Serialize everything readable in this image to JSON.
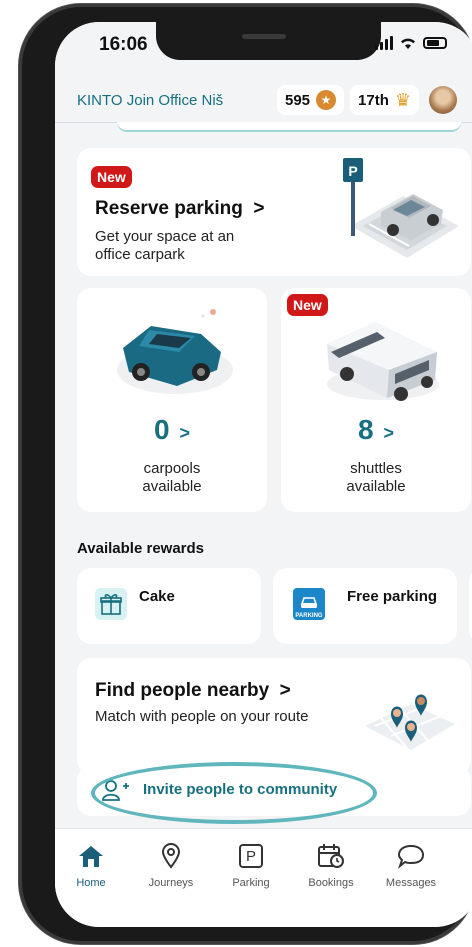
{
  "status_bar": {
    "time": "16:06"
  },
  "header": {
    "office": "KINTO Join Office Niš",
    "points": "595",
    "rank": "17th"
  },
  "reserve_parking": {
    "badge": "New",
    "title": "Reserve parking",
    "chevron": ">",
    "desc_line1": "Get your space at an",
    "desc_line2": "office carpark"
  },
  "carpools": {
    "count": "0",
    "chevron": ">",
    "label_line1": "carpools",
    "label_line2": "available"
  },
  "shuttles": {
    "badge": "New",
    "count": "8",
    "chevron": ">",
    "label_line1": "shuttles",
    "label_line2": "available"
  },
  "rewards": {
    "section_title": "Available rewards",
    "items": [
      {
        "label": "Cake"
      },
      {
        "label": "Free parking",
        "icon_text": "PARKING"
      }
    ]
  },
  "find_people": {
    "title": "Find people nearby",
    "chevron": ">",
    "desc": "Match with people on your route"
  },
  "invite": {
    "label": "Invite people to community"
  },
  "tabs": [
    {
      "label": "Home",
      "active": true
    },
    {
      "label": "Journeys"
    },
    {
      "label": "Parking",
      "icon_text": "P"
    },
    {
      "label": "Bookings"
    },
    {
      "label": "Messages"
    }
  ]
}
